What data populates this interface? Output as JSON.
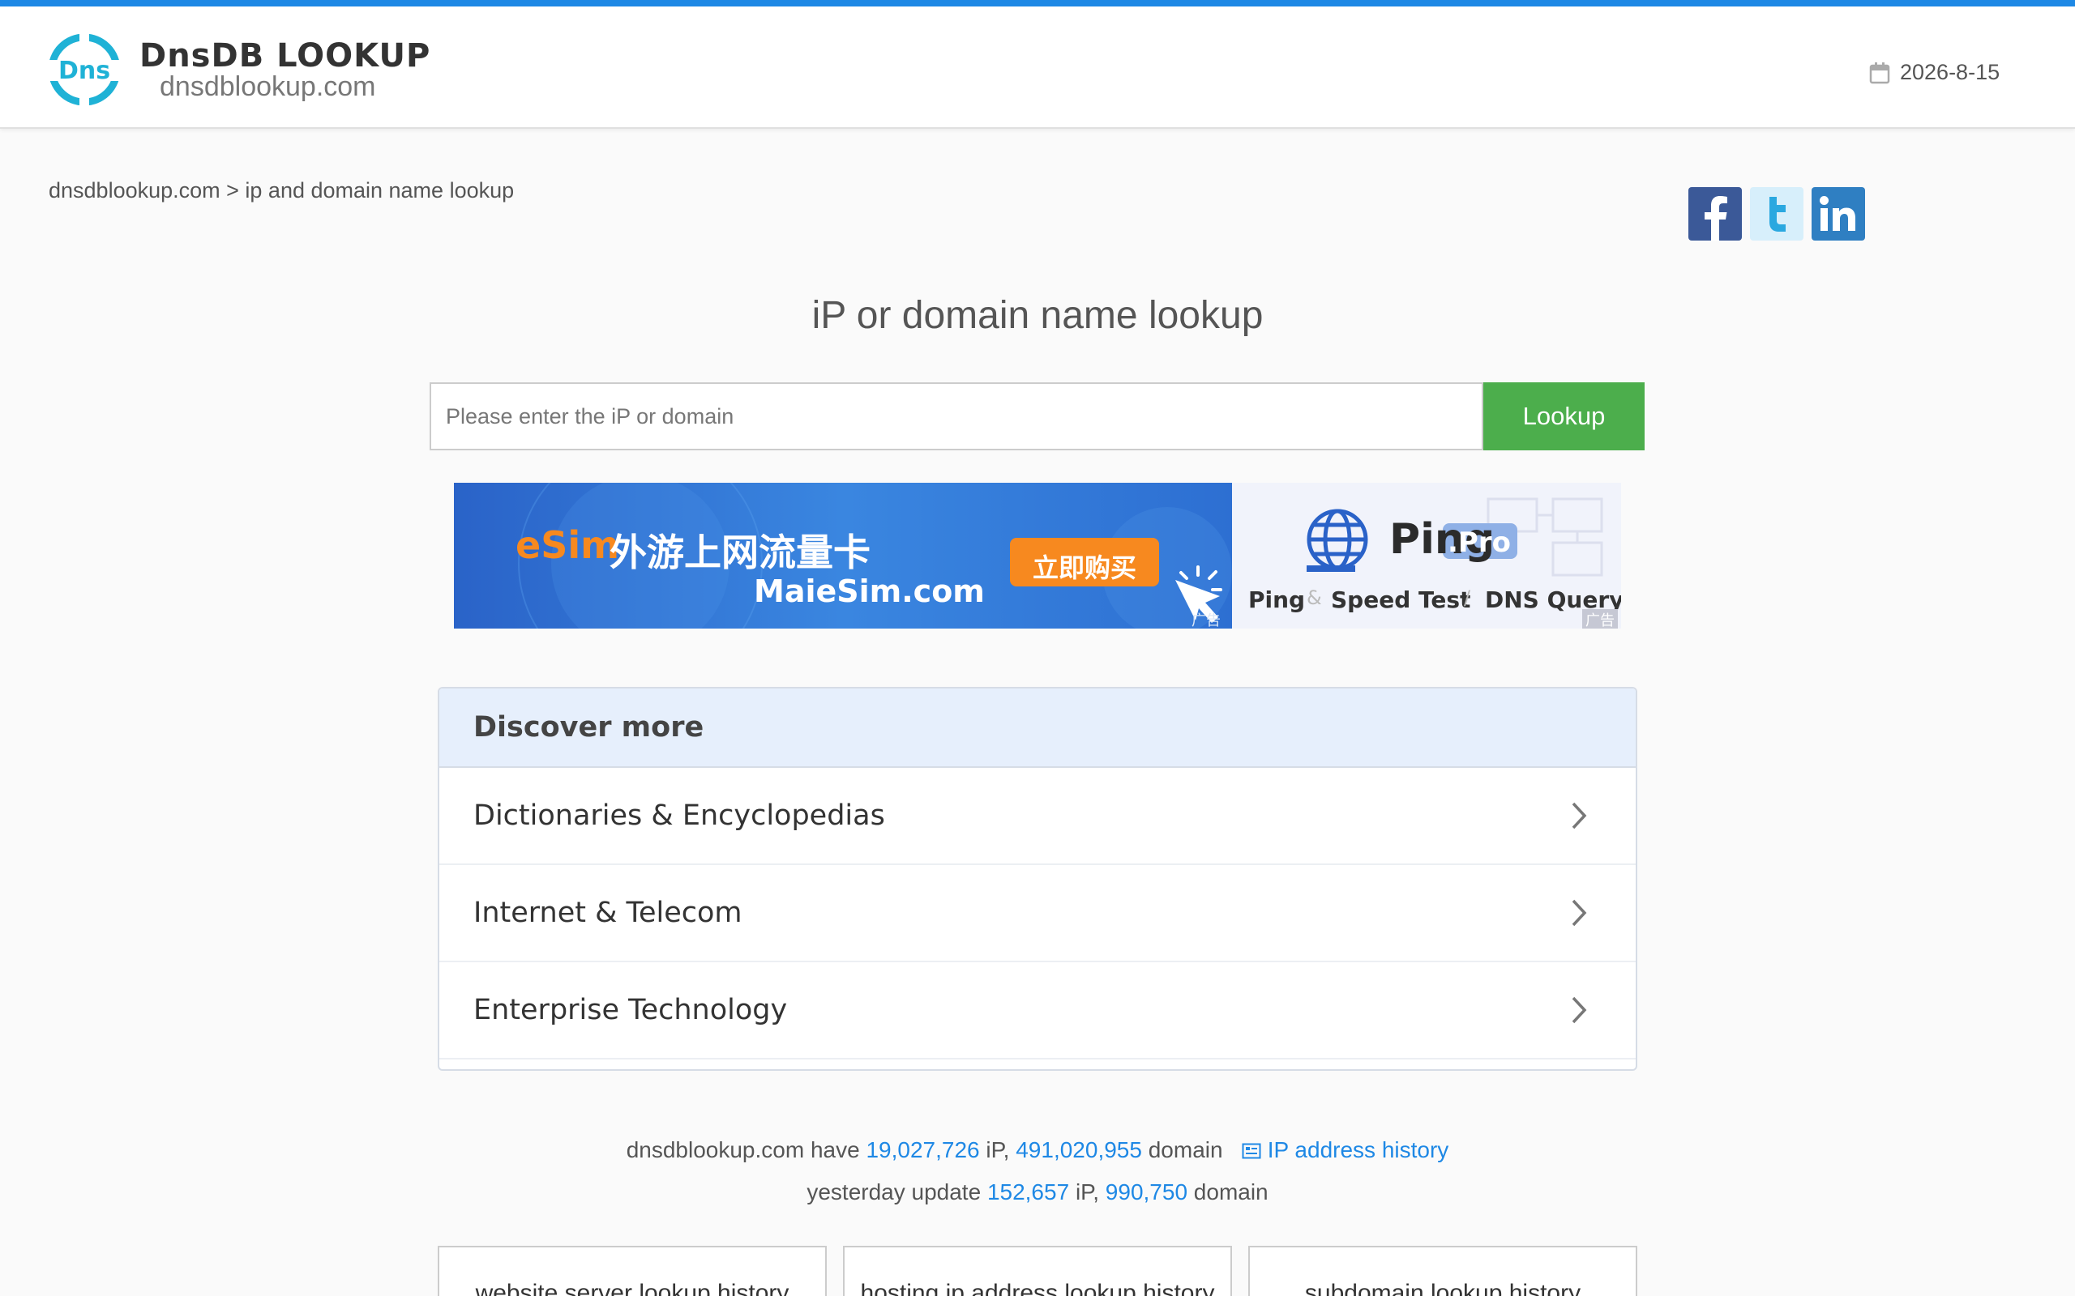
{
  "header": {
    "logo_title": "DnsDB LOOKUP",
    "logo_sub": "dnsdblookup.com",
    "date": "2026-8-15"
  },
  "breadcrumb": "dnsdblookup.com > ip and domain name lookup",
  "social": [
    "facebook-icon",
    "twitter-icon",
    "linkedin-icon"
  ],
  "main": {
    "title": "iP or domain name lookup",
    "search_placeholder": "Please enter the iP or domain",
    "lookup_label": "Lookup"
  },
  "ads": {
    "ad1": {
      "esim": "eSim",
      "cn_title": "外游上网流量卡",
      "site": "MaieSim.com",
      "buy": "立即购买",
      "badge": "广告"
    },
    "ad2": {
      "brand": "Ping",
      "pro": ".Pro",
      "tagline_1": "Ping",
      "tagline_2": "Speed Test",
      "tagline_3": "DNS Query",
      "badge": "广告"
    }
  },
  "discover": {
    "title": "Discover more",
    "items": [
      "Dictionaries & Encyclopedias",
      "Internet & Telecom",
      "Enterprise Technology"
    ]
  },
  "stats": {
    "line1_prefix": "dnsdblookup.com have",
    "ip_count": "19,027,726",
    "ip_word": "iP,",
    "domain_count": "491,020,955",
    "domain_word": "domain",
    "history_link": "IP address history",
    "line2_prefix": "yesterday update",
    "y_ip": "152,657",
    "y_ip_word": "iP,",
    "y_domain": "990,750",
    "y_domain_word": "domain"
  },
  "cards": [
    "website server lookup history",
    "hosting ip address lookup history",
    "subdomain lookup history"
  ],
  "colors": {
    "accent": "#1e88e5",
    "lookup": "#4cae4c",
    "panel_head": "#e6effc"
  }
}
